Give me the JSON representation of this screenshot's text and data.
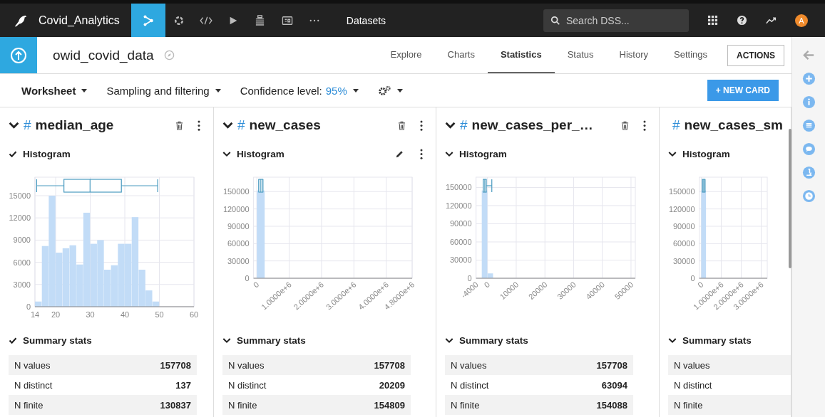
{
  "topbar": {
    "project": "Covid_Analytics",
    "section": "Datasets",
    "search": {
      "placeholder": "Search DSS..."
    },
    "avatar": "A",
    "tools": [
      {
        "kind": "flow",
        "selected": true
      },
      {
        "kind": "recipe",
        "selected": false
      },
      {
        "kind": "code",
        "selected": false
      },
      {
        "kind": "run",
        "selected": false
      },
      {
        "kind": "stack",
        "selected": false
      },
      {
        "kind": "dashboard",
        "selected": false
      },
      {
        "kind": "more",
        "selected": false
      }
    ]
  },
  "dataset": {
    "name": "owid_covid_data",
    "tabs": [
      {
        "label": "Explore",
        "selected": false
      },
      {
        "label": "Charts",
        "selected": false
      },
      {
        "label": "Statistics",
        "selected": true
      },
      {
        "label": "Status",
        "selected": false
      },
      {
        "label": "History",
        "selected": false
      },
      {
        "label": "Settings",
        "selected": false
      }
    ],
    "actions": "ACTIONS"
  },
  "toolbar": {
    "worksheet": "Worksheet",
    "sampling": "Sampling and filtering",
    "confidence_label": "Confidence level:",
    "confidence_value": "95%",
    "new_card": "+ NEW CARD"
  },
  "cards": [
    {
      "hash": "#",
      "title": "median_age",
      "header_actions": true,
      "histogram": {
        "label": "Histogram",
        "kind": "check",
        "edit": false,
        "menu": false
      },
      "chart_data": {
        "type": "bar",
        "x": [
          15,
          17,
          19,
          21,
          23,
          25,
          27,
          29,
          31,
          33,
          35,
          37,
          39,
          41,
          43,
          45,
          47,
          49
        ],
        "values": [
          700,
          8200,
          15000,
          7300,
          7900,
          8300,
          5700,
          12700,
          8500,
          9000,
          5000,
          5600,
          8500,
          8500,
          12100,
          5000,
          2200,
          700
        ],
        "xlim": [
          14,
          60
        ],
        "ylim": [
          0,
          17500
        ],
        "xticks": [
          14,
          20,
          30,
          40,
          50,
          60
        ],
        "yticks": [
          0,
          3000,
          6000,
          9000,
          12000,
          15000
        ],
        "grid": true
      },
      "summary": {
        "label": "Summary stats",
        "kind": "check",
        "rows": [
          {
            "name": "N values",
            "value": "157708"
          },
          {
            "name": "N distinct",
            "value": "137"
          },
          {
            "name": "N finite",
            "value": "130837"
          }
        ]
      }
    },
    {
      "hash": "#",
      "title": "new_cases",
      "header_actions": true,
      "histogram": {
        "label": "Histogram",
        "kind": "chevron",
        "edit": true,
        "menu": true
      },
      "chart_data": {
        "type": "bar",
        "x": [
          125000,
          375000
        ],
        "values": [
          152000,
          0
        ],
        "xlim": [
          -100000,
          4800000
        ],
        "ylim": [
          0,
          175000
        ],
        "xticks": [
          0,
          {
            "value": 1000000,
            "label": "1.0000e+6"
          },
          {
            "value": 2000000,
            "label": "2.0000e+6"
          },
          {
            "value": 3000000,
            "label": "3.0000e+6"
          },
          {
            "value": 4000000,
            "label": "4.0000e+6"
          },
          {
            "value": 4800000,
            "label": "4.8000e+6"
          }
        ],
        "yticks": [
          0,
          30000,
          60000,
          90000,
          120000,
          150000
        ],
        "grid": true
      },
      "summary": {
        "label": "Summary stats",
        "kind": "chevron",
        "rows": [
          {
            "name": "N values",
            "value": "157708"
          },
          {
            "name": "N distinct",
            "value": "20209"
          },
          {
            "name": "N finite",
            "value": "154809"
          }
        ]
      }
    },
    {
      "hash": "#",
      "title": "new_cases_per_…",
      "header_actions": true,
      "histogram": {
        "label": "Histogram",
        "kind": "chevron",
        "edit": false,
        "menu": false
      },
      "chart_data": {
        "type": "bar",
        "x": [
          -1000,
          1000,
          3000
        ],
        "values": [
          145000,
          8000,
          0
        ],
        "xlim": [
          -4000,
          51500
        ],
        "ylim": [
          0,
          167000
        ],
        "xticks": [
          -4000,
          0,
          10000,
          20000,
          30000,
          40000,
          50000
        ],
        "yticks": [
          0,
          30000,
          60000,
          90000,
          120000,
          150000
        ],
        "grid": true
      },
      "summary": {
        "label": "Summary stats",
        "kind": "chevron",
        "rows": [
          {
            "name": "N values",
            "value": "157708"
          },
          {
            "name": "N distinct",
            "value": "63094"
          },
          {
            "name": "N finite",
            "value": "154088"
          }
        ]
      }
    },
    {
      "hash": "#",
      "title": "new_cases_sm",
      "histogram": {
        "label": "Histogram",
        "kind": "chevron",
        "edit": false,
        "menu": false
      },
      "chart_data": {
        "type": "bar",
        "x": [
          125000,
          375000
        ],
        "values": [
          152000,
          0
        ],
        "xlim": [
          -100000,
          3300000
        ],
        "ylim": [
          0,
          175000
        ],
        "xticks": [
          0,
          {
            "value": 1000000,
            "label": "1.0000e+6"
          },
          {
            "value": 2000000,
            "label": "2.0000e+6"
          },
          {
            "value": 3000000,
            "label": "3.0000e+6"
          }
        ],
        "yticks": [
          0,
          30000,
          60000,
          90000,
          120000,
          150000
        ],
        "grid": true
      },
      "summary": {
        "label": "Summary stats",
        "kind": "chevron",
        "rows": [
          {
            "name": "N values"
          },
          {
            "name": "N distinct"
          },
          {
            "name": "N finite"
          }
        ]
      }
    }
  ],
  "right_rail": [
    {
      "kind": "back"
    },
    {
      "kind": "add"
    },
    {
      "kind": "info"
    },
    {
      "kind": "list"
    },
    {
      "kind": "chat"
    },
    {
      "kind": "lab"
    },
    {
      "kind": "clock"
    }
  ]
}
